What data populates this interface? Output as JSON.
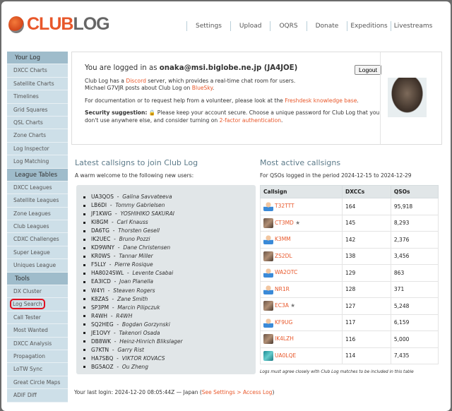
{
  "logo": {
    "text_part1": "CLUB",
    "text_part2": "LOG"
  },
  "nav": [
    "Settings",
    "Upload",
    "OQRS",
    "Donate",
    "Expeditions",
    "Livestreams"
  ],
  "sidebar": [
    {
      "label": "Your Log",
      "header": true
    },
    {
      "label": "DXCC Charts"
    },
    {
      "label": "Satellite Charts"
    },
    {
      "label": "Timelines"
    },
    {
      "label": "Grid Squares"
    },
    {
      "label": "QSL Charts"
    },
    {
      "label": "Zone Charts"
    },
    {
      "label": "Log Inspector"
    },
    {
      "label": "Log Matching"
    },
    {
      "label": "League Tables",
      "header": true
    },
    {
      "label": "DXCC Leagues"
    },
    {
      "label": "Satellite Leagues"
    },
    {
      "label": "Zone Leagues"
    },
    {
      "label": "Club Leagues"
    },
    {
      "label": "CDXC Challenges"
    },
    {
      "label": "Super League"
    },
    {
      "label": "Uniques League"
    },
    {
      "label": "Tools",
      "header": true
    },
    {
      "label": "DX Cluster"
    },
    {
      "label": "Log Search",
      "highlighted": true
    },
    {
      "label": "Call Tester"
    },
    {
      "label": "Most Wanted"
    },
    {
      "label": "DXCC Analysis"
    },
    {
      "label": "Propagation"
    },
    {
      "label": "LoTW Sync"
    },
    {
      "label": "Great Circle Maps"
    },
    {
      "label": "ADIF Diff"
    }
  ],
  "welcome": {
    "logged_in_prefix": "You are logged in as ",
    "user": "onaka@msi.biglobe.ne.jp (JA4JOE)",
    "logout": "Logout",
    "discord_pre": "Club Log has a ",
    "discord": "Discord",
    "discord_post": " server, which provides a real-time chat room for users.",
    "bluesky_pre": "Michael G7VJR posts about Club Log on ",
    "bluesky": "BlueSky",
    "bluesky_post": ".",
    "doc_pre": "For documentation or to request help from a volunteer, please look at the ",
    "doc_link": "Freshdesk knowledge base",
    "doc_post": ".",
    "sec_label": "Security suggestion:",
    "sec_text": " Please keep your account secure. Choose a unique password for Club Log that you don't use anywhere else, and consider turning on ",
    "sec_link": "2-factor authentication",
    "sec_post": "."
  },
  "latest": {
    "title": "Latest callsigns to join Club Log",
    "subtitle": "A warm welcome to the following new users:",
    "users": [
      [
        "UA3QOS",
        "Galina Savvateeva"
      ],
      [
        "LB6DI",
        "Tommy Gabrielsen"
      ],
      [
        "JF1KWG",
        "YOSHIHIKO SAKURAI"
      ],
      [
        "KI8GM",
        "Carl Knauss"
      ],
      [
        "DA6TG",
        "Thorsten Gesell"
      ],
      [
        "IK2UEC",
        "Bruno Pozzi"
      ],
      [
        "KD9WNY",
        "Dane Christensen"
      ],
      [
        "KR0WS",
        "Tannar Miller"
      ],
      [
        "F5LLY",
        "Pierre Rosique"
      ],
      [
        "HA8024SWL",
        "Levente Csabai"
      ],
      [
        "EA3ICD",
        "Joan Planella"
      ],
      [
        "W4YI",
        "Steaven Rogers"
      ],
      [
        "K8ZAS",
        "Zane Smith"
      ],
      [
        "SP3PM",
        "Marcin Pilipczuk"
      ],
      [
        "R4WH",
        "R4WH"
      ],
      [
        "SQ2HEG",
        "Bogdan Gorzynski"
      ],
      [
        "JE1OVY",
        "Takenori Osada"
      ],
      [
        "DB8WK",
        "Heinz-Hinrich Blikslager"
      ],
      [
        "G7KTN",
        "Garry Rist"
      ],
      [
        "HA7SBQ",
        "VIKTOR KOVACS"
      ],
      [
        "BG5AOZ",
        "Ou Zheng"
      ]
    ]
  },
  "active": {
    "title": "Most active callsigns",
    "subtitle": "For QSOs logged in the period 2024-12-15 to 2024-12-29",
    "columns": [
      "Callsign",
      "DXCCs",
      "QSOs"
    ],
    "rows": [
      [
        "T32TTT",
        "164",
        "95,918",
        "u",
        ""
      ],
      [
        "CT3MD",
        "145",
        "8,293",
        "p",
        "★"
      ],
      [
        "K3MM",
        "142",
        "2,376",
        "u",
        ""
      ],
      [
        "ZS2DL",
        "138",
        "3,456",
        "p",
        ""
      ],
      [
        "WA2OTC",
        "129",
        "863",
        "u",
        ""
      ],
      [
        "NR1R",
        "128",
        "371",
        "u",
        ""
      ],
      [
        "EC3A",
        "127",
        "5,248",
        "p",
        "★"
      ],
      [
        "KF9UG",
        "117",
        "6,159",
        "u",
        ""
      ],
      [
        "IK4LZH",
        "116",
        "5,000",
        "p",
        ""
      ],
      [
        "UA0LQE",
        "114",
        "7,435",
        "s",
        ""
      ]
    ],
    "note": "Logs must agree closely with Club Log matches to be included in this table"
  },
  "last_login": {
    "text": "Your last login: 2024-12-20 08:05:44Z — Japan (",
    "link": "See Settings > Access Log",
    "close": ")"
  }
}
